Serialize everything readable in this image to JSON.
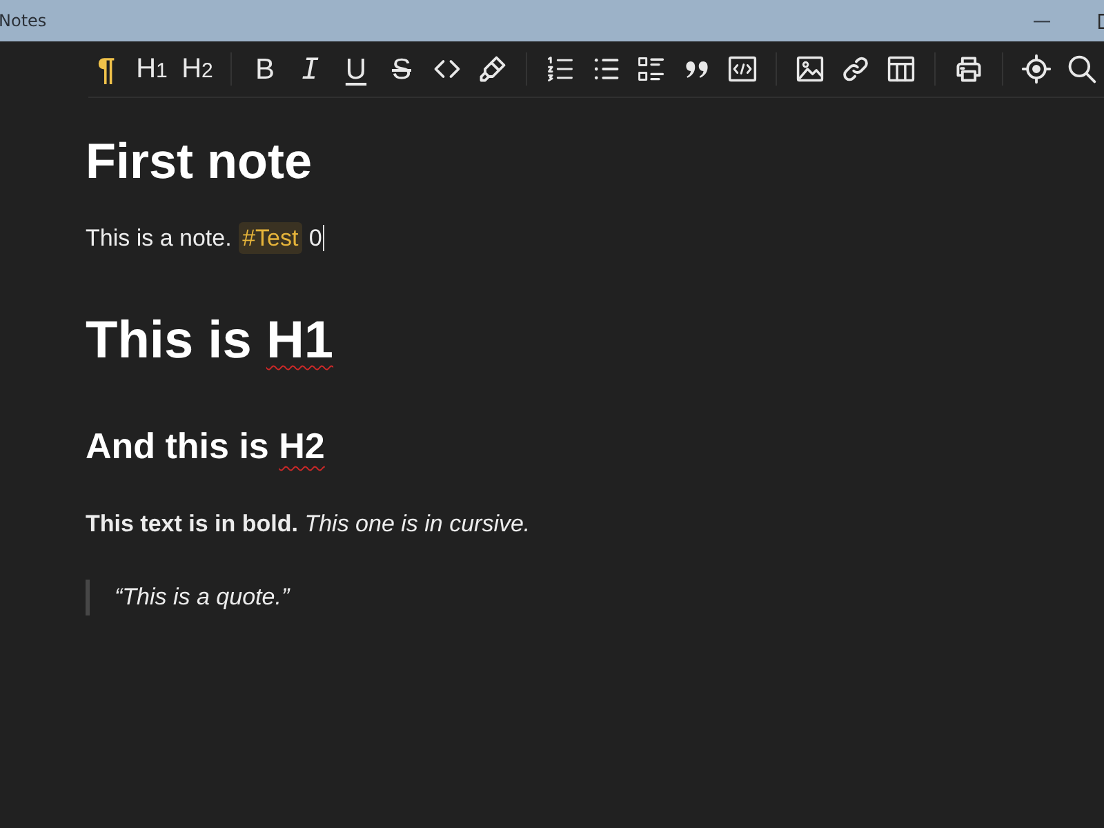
{
  "window": {
    "title": "Notes"
  },
  "toolbar": {
    "groups": [
      [
        {
          "kind": "paragraph",
          "label": "¶",
          "selected": true
        },
        {
          "kind": "heading",
          "label": "H$_{1}$",
          "selected": false
        },
        {
          "kind": "heading",
          "label": "H$_{2}$",
          "selected": false
        }
      ],
      [
        {
          "kind": "bold",
          "label": "B",
          "selected": false
        },
        {
          "kind": "italic",
          "label": "I",
          "selected": false
        },
        {
          "kind": "underline",
          "label": "U",
          "selected": false
        },
        {
          "kind": "strike",
          "label": "S",
          "selected": false
        },
        {
          "kind": "code",
          "selected": false
        },
        {
          "kind": "highlight",
          "selected": false
        }
      ],
      [
        {
          "kind": "numbered",
          "selected": false
        },
        {
          "kind": "bulleted",
          "selected": false
        },
        {
          "kind": "tasks",
          "selected": false
        },
        {
          "kind": "quote",
          "selected": false
        },
        {
          "kind": "codeblock",
          "selected": false
        }
      ],
      [
        {
          "kind": "image",
          "selected": false
        },
        {
          "kind": "link",
          "selected": false
        },
        {
          "kind": "table",
          "selected": false
        }
      ],
      [
        {
          "kind": "print",
          "selected": false
        }
      ],
      [
        {
          "kind": "focus",
          "selected": false
        },
        {
          "kind": "search",
          "selected": false
        }
      ]
    ]
  },
  "content": {
    "blocks": [
      {
        "kind": "h1",
        "text": "First note"
      },
      {
        "kind": "paragraph",
        "text": "This is a note.",
        "tag": "#Test",
        "after": "0",
        "cursor": true
      },
      {
        "kind": "h1",
        "text": "This is",
        "misspelled": "H1"
      },
      {
        "kind": "h2",
        "text": "And this is",
        "misspelled": "H2"
      },
      {
        "kind": "paragraph",
        "text": "**This text is in bold.** *This one is in cursive.*"
      },
      {
        "kind": "quote",
        "text": "“This is a quote.”"
      }
    ]
  }
}
